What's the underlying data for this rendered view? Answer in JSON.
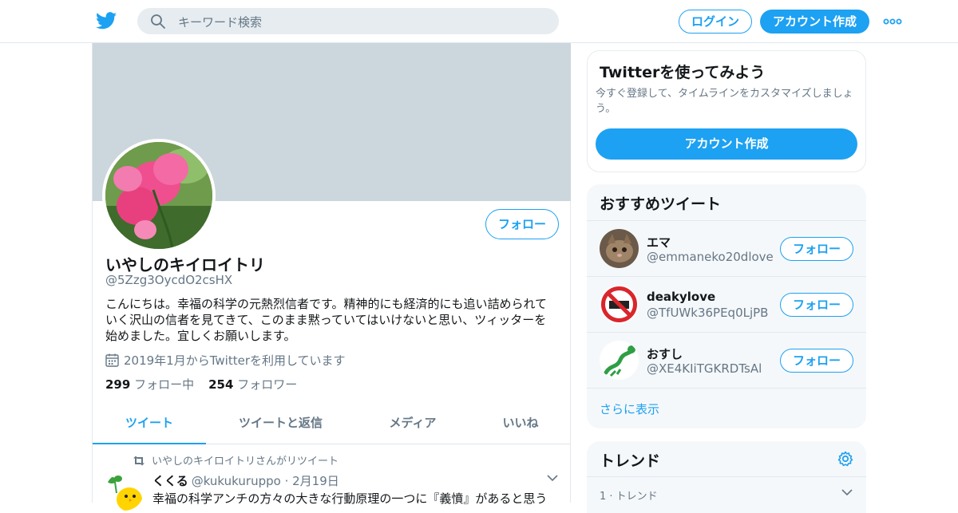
{
  "header": {
    "search_placeholder": "キーワード検索",
    "login_label": "ログイン",
    "signup_label": "アカウント作成"
  },
  "profile": {
    "name": "いやしのキイロイトリ",
    "handle": "@5Zzg3OycdO2csHX",
    "follow_label": "フォロー",
    "bio_lines": [
      "こんにちは。幸福の科学の元熱烈信者です。精神的にも経済的にも追い詰められて",
      "いく沢山の信者を見てきて、このまま黙っていてはいけないと思い、ツィッターを",
      "始めました。宜しくお願いします。"
    ],
    "joined": "2019年1月からTwitterを利用しています",
    "following_count": "299",
    "following_label": "フォロー中",
    "followers_count": "254",
    "followers_label": "フォロワー"
  },
  "tabs": [
    "ツイート",
    "ツイートと返信",
    "メディア",
    "いいね"
  ],
  "tweet": {
    "retweet_note": "いやしのキイロイトリさんがリツイート",
    "author_name": "くくる",
    "author_handle": "@kukukuruppo",
    "date": "· 2月19日",
    "text": "幸福の科学アンチの方々の大きな行動原理の一つに『義憤』があると思う"
  },
  "signup_card": {
    "title": "Twitterを使ってみよう",
    "body": "今すぐ登録して、タイムラインをカスタマイズしましょう。",
    "cta": "アカウント作成"
  },
  "recommended": {
    "title": "おすすめツイート",
    "follow_label": "フォロー",
    "items": [
      {
        "name": "エマ",
        "handle": "@emmaneko20dlove"
      },
      {
        "name": "deakylove",
        "handle": "@TfUWk36PEq0LjPB"
      },
      {
        "name": "おすし",
        "handle": "@XE4KIiTGKRDTsAl"
      }
    ],
    "show_more": "さらに表示"
  },
  "trends": {
    "title": "トレンド",
    "first_label": "1 · トレンド"
  },
  "colors": {
    "accent": "#1da1f2",
    "banner": "#ccd6dd",
    "muted_text": "#657786",
    "panel_bg": "#f5f8fa"
  },
  "icons": [
    "twitter-bird-icon",
    "search-icon",
    "more-dots-icon",
    "calendar-icon",
    "retweet-icon",
    "chevron-down-icon",
    "gear-icon"
  ]
}
